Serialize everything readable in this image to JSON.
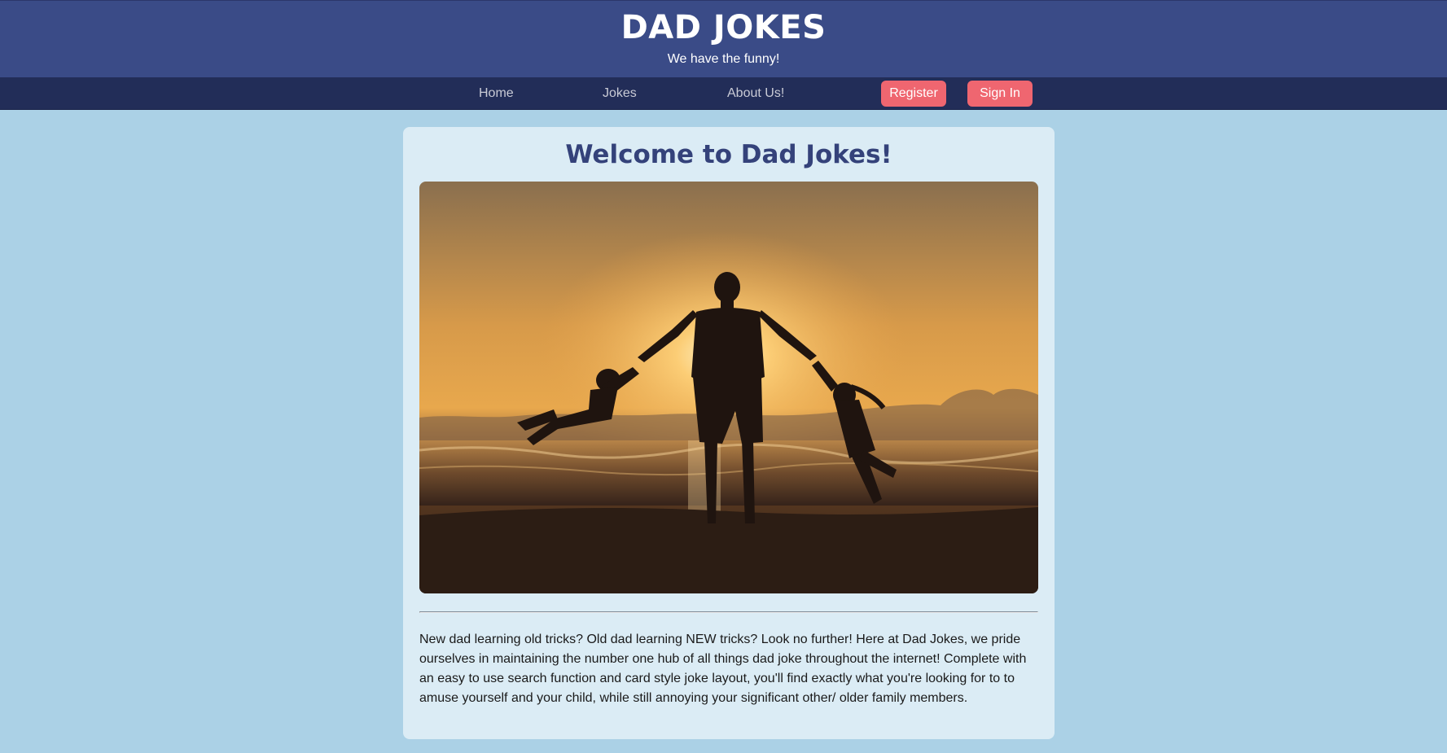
{
  "header": {
    "title": "DAD JOKES",
    "tagline": "We have the funny!"
  },
  "nav": {
    "links": [
      "Home",
      "Jokes",
      "About Us!"
    ],
    "register_label": "Register",
    "signin_label": "Sign In"
  },
  "main": {
    "heading": "Welcome to Dad Jokes!",
    "intro": "New dad learning old tricks? Old dad learning NEW tricks? Look no further! Here at Dad Jokes, we pride ourselves in maintaining the number one hub of all things dad joke throughout the internet! Complete with an easy to use search function and card style joke layout, you'll find exactly what you're looking for to to amuse yourself and your child, while still annoying your significant other/ older family members."
  },
  "colors": {
    "header_bg": "#3a4b87",
    "nav_bg": "#222d58",
    "page_bg": "#abd1e6",
    "card_bg": "#dbecf5",
    "button_bg": "#ef6670",
    "heading": "#34427a"
  }
}
